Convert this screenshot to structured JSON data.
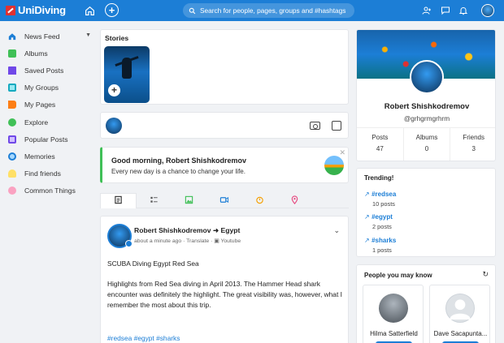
{
  "app": {
    "name": "UniDiving"
  },
  "search": {
    "placeholder": "Search for people, pages, groups and #hashtags"
  },
  "sidebar": {
    "items": [
      {
        "label": "News Feed",
        "icon": "home-icon",
        "color": "#1c7ed6"
      },
      {
        "label": "Albums",
        "icon": "image-icon",
        "color": "#40c057"
      },
      {
        "label": "Saved Posts",
        "icon": "bookmark-icon",
        "color": "#7048e8"
      },
      {
        "label": "My Groups",
        "icon": "groups-icon",
        "color": "#15aabf"
      },
      {
        "label": "My Pages",
        "icon": "flag-icon",
        "color": "#fd7e14"
      },
      {
        "label": "Explore",
        "icon": "compass-icon",
        "color": "#40c057"
      },
      {
        "label": "Popular Posts",
        "icon": "document-icon",
        "color": "#7048e8"
      },
      {
        "label": "Memories",
        "icon": "clock-icon",
        "color": "#1c7ed6"
      },
      {
        "label": "Find friends",
        "icon": "person-search-icon",
        "color": "#fab005"
      },
      {
        "label": "Common Things",
        "icon": "pills-icon",
        "color": "#e64980"
      }
    ]
  },
  "stories": {
    "title": "Stories"
  },
  "greeting": {
    "title": "Good morning, Robert Shishkodremov",
    "subtitle": "Every new day is a chance to change your life."
  },
  "post": {
    "author": "Robert Shishkodremov",
    "target": "Egypt",
    "meta_time": "about a minute ago",
    "meta_translate": "Translate",
    "meta_source": "Youtube",
    "title_line": "SCUBA Diving Egypt Red Sea",
    "body_line1": "Highlights from Red Sea diving in April 2013. The Hammer Head shark",
    "body_line2": "encounter was definitely the highlight. The great visibility was, however, what I",
    "body_line3": "remember the most about this trip.",
    "hashtags": "#redsea #egypt #sharks"
  },
  "profile": {
    "name": "Robert Shishkodremov",
    "handle": "@grhgrmgrhrm",
    "stats": [
      {
        "label": "Posts",
        "value": "47"
      },
      {
        "label": "Albums",
        "value": "0"
      },
      {
        "label": "Friends",
        "value": "3"
      }
    ]
  },
  "trending": {
    "title": "Trending!",
    "items": [
      {
        "tag": "#redsea",
        "count": "10 posts"
      },
      {
        "tag": "#egypt",
        "count": "2 posts"
      },
      {
        "tag": "#sharks",
        "count": "1 posts"
      }
    ]
  },
  "people": {
    "title": "People you may know",
    "items": [
      {
        "name": "Hilma Satterfield"
      },
      {
        "name": "Dave Sacapunta..."
      }
    ]
  },
  "colors": {
    "brand": "#1c7ed6",
    "greeting_accent": "#40c057"
  }
}
